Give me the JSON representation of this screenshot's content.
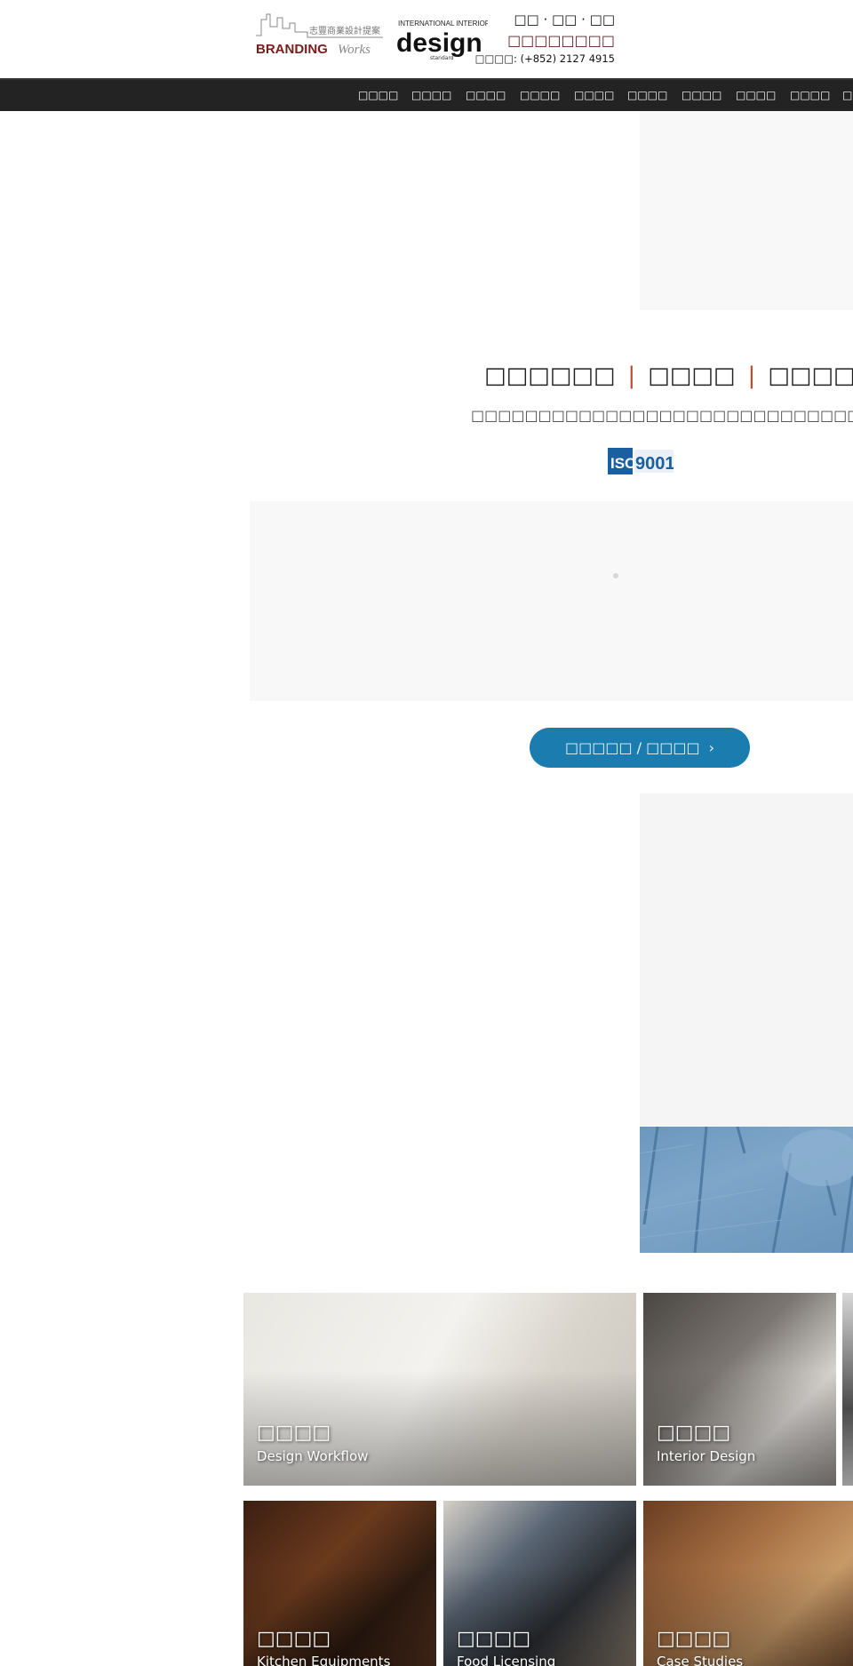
{
  "header": {
    "logo_branding": {
      "tagline_zh": "志豐商業設計提案",
      "word1": "BRANDING",
      "word2": "Works"
    },
    "logo_design": {
      "top": "INTERNATIONAL INTERIOR",
      "main": "design",
      "sub": "standard"
    },
    "line1": "□□ · □□ · □□",
    "line2": "□□□□□□□□",
    "line3": "□□□□: (+852) 2127 4915"
  },
  "nav": {
    "items": [
      {
        "label": "□□□□"
      },
      {
        "label": "□□□□"
      },
      {
        "label": "□□□□"
      },
      {
        "label": "□□□□"
      },
      {
        "label": "□□□□"
      },
      {
        "label": "□□□□"
      },
      {
        "label": "□□□□"
      },
      {
        "label": "□□□□"
      },
      {
        "label": "□□□□"
      },
      {
        "label": "□□"
      }
    ]
  },
  "intro": {
    "tagline_parts": [
      "□□□□□□",
      "□□□□",
      "□□□□"
    ],
    "separator": "|",
    "subtitle": "□□□□□□□□□□□□□□□□□□□□□□□□□□□□□□□□□□□□□",
    "iso_badge": {
      "left": "ISO",
      "right": "9001"
    }
  },
  "cta": {
    "label": "□□□□□ / □□□□",
    "icon": "chevron-right"
  },
  "tiles": [
    {
      "title_zh": "□□□□",
      "title_en": "Design Workflow"
    },
    {
      "title_zh": "□□□□",
      "title_en": "Interior Design"
    },
    {
      "title_zh": "□□□□",
      "title_en": "Kitchen Equipments"
    },
    {
      "title_zh": "□□□□",
      "title_en": "Food Licensing"
    },
    {
      "title_zh": "□□□□",
      "title_en": "Case Studies"
    }
  ],
  "colors": {
    "nav_bg": "#232323",
    "cta_bg": "#1b7cb0",
    "separator": "#c0492b",
    "brand_red": "#7a1c1c"
  }
}
